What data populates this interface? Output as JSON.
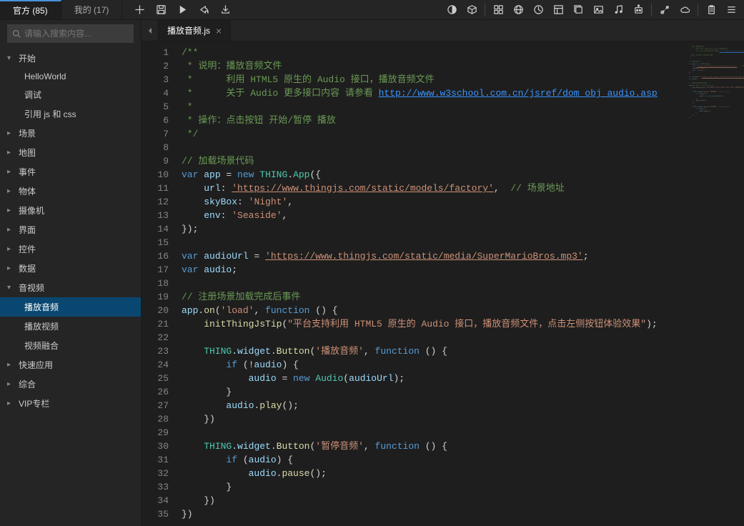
{
  "topTabs": [
    {
      "label": "官方 (85)",
      "active": true
    },
    {
      "label": "我的 (17)",
      "active": false
    }
  ],
  "search": {
    "placeholder": "请输入搜索内容..."
  },
  "tree": [
    {
      "label": "开始",
      "expanded": true,
      "depth": 0,
      "leaf": false
    },
    {
      "label": "HelloWorld",
      "depth": 1,
      "leaf": true
    },
    {
      "label": "调试",
      "depth": 1,
      "leaf": true
    },
    {
      "label": "引用 js 和 css",
      "depth": 1,
      "leaf": true
    },
    {
      "label": "场景",
      "expanded": false,
      "depth": 0,
      "leaf": false
    },
    {
      "label": "地图",
      "expanded": false,
      "depth": 0,
      "leaf": false
    },
    {
      "label": "事件",
      "expanded": false,
      "depth": 0,
      "leaf": false
    },
    {
      "label": "物体",
      "expanded": false,
      "depth": 0,
      "leaf": false
    },
    {
      "label": "摄像机",
      "expanded": false,
      "depth": 0,
      "leaf": false
    },
    {
      "label": "界面",
      "expanded": false,
      "depth": 0,
      "leaf": false
    },
    {
      "label": "控件",
      "expanded": false,
      "depth": 0,
      "leaf": false
    },
    {
      "label": "数据",
      "expanded": false,
      "depth": 0,
      "leaf": false
    },
    {
      "label": "音视频",
      "expanded": true,
      "depth": 0,
      "leaf": false
    },
    {
      "label": "播放音频",
      "depth": 1,
      "leaf": true,
      "selected": true
    },
    {
      "label": "播放视频",
      "depth": 1,
      "leaf": true
    },
    {
      "label": "视频融合",
      "depth": 1,
      "leaf": true
    },
    {
      "label": "快速应用",
      "expanded": false,
      "depth": 0,
      "leaf": false
    },
    {
      "label": "综合",
      "expanded": false,
      "depth": 0,
      "leaf": false
    },
    {
      "label": "VIP专栏",
      "expanded": false,
      "depth": 0,
      "leaf": false
    }
  ],
  "editorTab": {
    "label": "播放音频.js"
  },
  "code": {
    "lines": [
      {
        "n": 1,
        "seg": [
          {
            "c": "tok-c",
            "t": "/**"
          }
        ]
      },
      {
        "n": 2,
        "seg": [
          {
            "c": "tok-c",
            "t": " * 说明：播放音频文件"
          }
        ]
      },
      {
        "n": 3,
        "seg": [
          {
            "c": "tok-c",
            "t": " *      利用 HTML5 原生的 Audio 接口，播放音频文件"
          }
        ]
      },
      {
        "n": 4,
        "seg": [
          {
            "c": "tok-c",
            "t": " *      关于 Audio 更多接口内容 请参看 "
          },
          {
            "c": "tok-lu",
            "t": "http://www.w3school.com.cn/jsref/dom_obj_audio.asp"
          }
        ]
      },
      {
        "n": 5,
        "seg": [
          {
            "c": "tok-c",
            "t": " *"
          }
        ]
      },
      {
        "n": 6,
        "seg": [
          {
            "c": "tok-c",
            "t": " * 操作：点击按钮 开始/暂停 播放"
          }
        ]
      },
      {
        "n": 7,
        "seg": [
          {
            "c": "tok-c",
            "t": " */"
          }
        ]
      },
      {
        "n": 8,
        "seg": []
      },
      {
        "n": 9,
        "seg": [
          {
            "c": "tok-c",
            "t": "// 加载场景代码"
          }
        ]
      },
      {
        "n": 10,
        "seg": [
          {
            "c": "tok-k",
            "t": "var"
          },
          {
            "c": "tok-p",
            "t": " "
          },
          {
            "c": "tok-n",
            "t": "app"
          },
          {
            "c": "tok-p",
            "t": " = "
          },
          {
            "c": "tok-k",
            "t": "new"
          },
          {
            "c": "tok-p",
            "t": " "
          },
          {
            "c": "tok-t",
            "t": "THING"
          },
          {
            "c": "tok-p",
            "t": "."
          },
          {
            "c": "tok-t",
            "t": "App"
          },
          {
            "c": "tok-p",
            "t": "({"
          }
        ]
      },
      {
        "n": 11,
        "seg": [
          {
            "c": "tok-p",
            "t": "    "
          },
          {
            "c": "tok-n",
            "t": "url"
          },
          {
            "c": "tok-p",
            "t": ": "
          },
          {
            "c": "tok-u",
            "t": "'https://www.thingjs.com/static/models/factory'"
          },
          {
            "c": "tok-p",
            "t": ",  "
          },
          {
            "c": "tok-c",
            "t": "// 场景地址"
          }
        ]
      },
      {
        "n": 12,
        "seg": [
          {
            "c": "tok-p",
            "t": "    "
          },
          {
            "c": "tok-n",
            "t": "skyBox"
          },
          {
            "c": "tok-p",
            "t": ": "
          },
          {
            "c": "tok-s",
            "t": "'Night'"
          },
          {
            "c": "tok-p",
            "t": ","
          }
        ]
      },
      {
        "n": 13,
        "seg": [
          {
            "c": "tok-p",
            "t": "    "
          },
          {
            "c": "tok-n",
            "t": "env"
          },
          {
            "c": "tok-p",
            "t": ": "
          },
          {
            "c": "tok-s",
            "t": "'Seaside'"
          },
          {
            "c": "tok-p",
            "t": ","
          }
        ]
      },
      {
        "n": 14,
        "seg": [
          {
            "c": "tok-p",
            "t": "});"
          }
        ]
      },
      {
        "n": 15,
        "seg": []
      },
      {
        "n": 16,
        "seg": [
          {
            "c": "tok-k",
            "t": "var"
          },
          {
            "c": "tok-p",
            "t": " "
          },
          {
            "c": "tok-n",
            "t": "audioUrl"
          },
          {
            "c": "tok-p",
            "t": " = "
          },
          {
            "c": "tok-u",
            "t": "'https://www.thingjs.com/static/media/SuperMarioBros.mp3'"
          },
          {
            "c": "tok-p",
            "t": ";"
          }
        ]
      },
      {
        "n": 17,
        "seg": [
          {
            "c": "tok-k",
            "t": "var"
          },
          {
            "c": "tok-p",
            "t": " "
          },
          {
            "c": "tok-n",
            "t": "audio"
          },
          {
            "c": "tok-p",
            "t": ";"
          }
        ]
      },
      {
        "n": 18,
        "seg": []
      },
      {
        "n": 19,
        "seg": [
          {
            "c": "tok-c",
            "t": "// 注册场景加载完成后事件"
          }
        ]
      },
      {
        "n": 20,
        "seg": [
          {
            "c": "tok-n",
            "t": "app"
          },
          {
            "c": "tok-p",
            "t": "."
          },
          {
            "c": "tok-f",
            "t": "on"
          },
          {
            "c": "tok-p",
            "t": "("
          },
          {
            "c": "tok-s",
            "t": "'load'"
          },
          {
            "c": "tok-p",
            "t": ", "
          },
          {
            "c": "tok-k",
            "t": "function"
          },
          {
            "c": "tok-p",
            "t": " () {"
          }
        ]
      },
      {
        "n": 21,
        "seg": [
          {
            "c": "tok-p",
            "t": "    "
          },
          {
            "c": "tok-f",
            "t": "initThingJsTip"
          },
          {
            "c": "tok-p",
            "t": "("
          },
          {
            "c": "tok-s",
            "t": "\"平台支持利用 HTML5 原生的 Audio 接口，播放音频文件，点击左侧按钮体验效果\""
          },
          {
            "c": "tok-p",
            "t": ");"
          }
        ]
      },
      {
        "n": 22,
        "seg": []
      },
      {
        "n": 23,
        "seg": [
          {
            "c": "tok-p",
            "t": "    "
          },
          {
            "c": "tok-t",
            "t": "THING"
          },
          {
            "c": "tok-p",
            "t": "."
          },
          {
            "c": "tok-n",
            "t": "widget"
          },
          {
            "c": "tok-p",
            "t": "."
          },
          {
            "c": "tok-f",
            "t": "Button"
          },
          {
            "c": "tok-p",
            "t": "("
          },
          {
            "c": "tok-s",
            "t": "'播放音频'"
          },
          {
            "c": "tok-p",
            "t": ", "
          },
          {
            "c": "tok-k",
            "t": "function"
          },
          {
            "c": "tok-p",
            "t": " () {"
          }
        ]
      },
      {
        "n": 24,
        "seg": [
          {
            "c": "tok-p",
            "t": "        "
          },
          {
            "c": "tok-k",
            "t": "if"
          },
          {
            "c": "tok-p",
            "t": " (!"
          },
          {
            "c": "tok-n",
            "t": "audio"
          },
          {
            "c": "tok-p",
            "t": ") {"
          }
        ]
      },
      {
        "n": 25,
        "seg": [
          {
            "c": "tok-p",
            "t": "            "
          },
          {
            "c": "tok-n",
            "t": "audio"
          },
          {
            "c": "tok-p",
            "t": " = "
          },
          {
            "c": "tok-k",
            "t": "new"
          },
          {
            "c": "tok-p",
            "t": " "
          },
          {
            "c": "tok-t",
            "t": "Audio"
          },
          {
            "c": "tok-p",
            "t": "("
          },
          {
            "c": "tok-n",
            "t": "audioUrl"
          },
          {
            "c": "tok-p",
            "t": ");"
          }
        ]
      },
      {
        "n": 26,
        "seg": [
          {
            "c": "tok-p",
            "t": "        }"
          }
        ]
      },
      {
        "n": 27,
        "seg": [
          {
            "c": "tok-p",
            "t": "        "
          },
          {
            "c": "tok-n",
            "t": "audio"
          },
          {
            "c": "tok-p",
            "t": "."
          },
          {
            "c": "tok-f",
            "t": "play"
          },
          {
            "c": "tok-p",
            "t": "();"
          }
        ]
      },
      {
        "n": 28,
        "seg": [
          {
            "c": "tok-p",
            "t": "    })"
          }
        ]
      },
      {
        "n": 29,
        "seg": []
      },
      {
        "n": 30,
        "seg": [
          {
            "c": "tok-p",
            "t": "    "
          },
          {
            "c": "tok-t",
            "t": "THING"
          },
          {
            "c": "tok-p",
            "t": "."
          },
          {
            "c": "tok-n",
            "t": "widget"
          },
          {
            "c": "tok-p",
            "t": "."
          },
          {
            "c": "tok-f",
            "t": "Button"
          },
          {
            "c": "tok-p",
            "t": "("
          },
          {
            "c": "tok-s",
            "t": "'暂停音频'"
          },
          {
            "c": "tok-p",
            "t": ", "
          },
          {
            "c": "tok-k",
            "t": "function"
          },
          {
            "c": "tok-p",
            "t": " () {"
          }
        ]
      },
      {
        "n": 31,
        "seg": [
          {
            "c": "tok-p",
            "t": "        "
          },
          {
            "c": "tok-k",
            "t": "if"
          },
          {
            "c": "tok-p",
            "t": " ("
          },
          {
            "c": "tok-n",
            "t": "audio"
          },
          {
            "c": "tok-p",
            "t": ") {"
          }
        ]
      },
      {
        "n": 32,
        "seg": [
          {
            "c": "tok-p",
            "t": "            "
          },
          {
            "c": "tok-n",
            "t": "audio"
          },
          {
            "c": "tok-p",
            "t": "."
          },
          {
            "c": "tok-f",
            "t": "pause"
          },
          {
            "c": "tok-p",
            "t": "();"
          }
        ]
      },
      {
        "n": 33,
        "seg": [
          {
            "c": "tok-p",
            "t": "        }"
          }
        ]
      },
      {
        "n": 34,
        "seg": [
          {
            "c": "tok-p",
            "t": "    })"
          }
        ]
      },
      {
        "n": 35,
        "seg": [
          {
            "c": "tok-p",
            "t": "})"
          }
        ]
      }
    ]
  },
  "toolbarIcons": [
    "plus",
    "save",
    "play",
    "share",
    "download"
  ],
  "rightIcons1": [
    "circle-half",
    "cube"
  ],
  "rightIcons2": [
    "grid",
    "globe",
    "clock",
    "layout",
    "copy",
    "image",
    "music",
    "robot"
  ],
  "rightIcons3": [
    "tools",
    "cloud"
  ],
  "rightIcons4": [
    "clipboard",
    "menu"
  ]
}
